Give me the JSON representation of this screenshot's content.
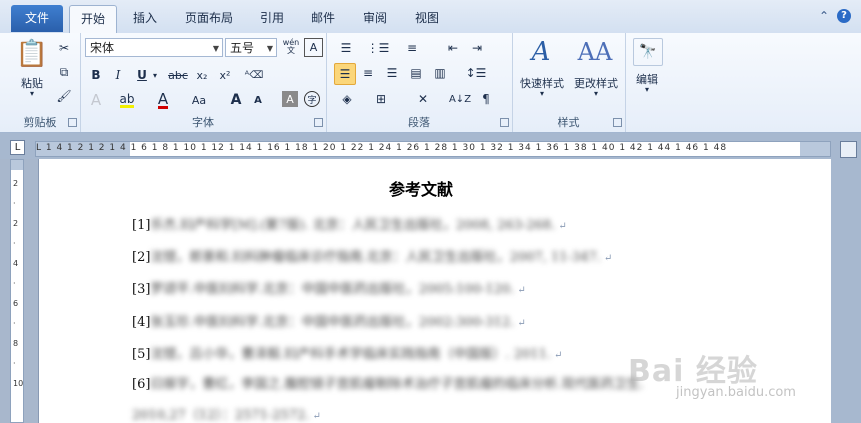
{
  "ribbon_tabs": {
    "file": "文件",
    "tabs": [
      "开始",
      "插入",
      "页面布局",
      "引用",
      "邮件",
      "审阅",
      "视图"
    ],
    "active_index": 0
  },
  "clipboard": {
    "paste": "粘贴",
    "group": "剪贴板"
  },
  "font": {
    "name": "宋体",
    "size": "五号",
    "group": "字体",
    "wen": "wén",
    "bold": "B",
    "italic": "I",
    "underline": "U",
    "strike": "abc",
    "sub": "x₂",
    "sup": "x²",
    "aa": "Aa",
    "grow": "A",
    "shrink": "A"
  },
  "paragraph": {
    "group": "段落"
  },
  "styles": {
    "quick": "快速样式",
    "change": "更改样式",
    "group": "样式"
  },
  "editing": {
    "label": "编辑"
  },
  "ruler": {
    "numbers": "L  1  4  1  2  1        2  1  4  1  6  1  8  1  10  1  12  1  14  1  16  1  18  1  20  1  22  1  24  1  26  1  28  1  30  1  32  1  34  1  36  1  38  1  40  1  42  1  44  1  46  1  48"
  },
  "document": {
    "title": "参考文献",
    "references": [
      {
        "num": "[1]",
        "text": "乐杰.妇产科学[M].(第7版). 北京：人民卫生出版社，2008, 263-268."
      },
      {
        "num": "[2]",
        "text": "沈铿，郎景和.妇科肿瘤临床诊疗指南.北京：人民卫生出版社，2007, 11-347."
      },
      {
        "num": "[3]",
        "text": "罗颂平.中医妇科学.北京：中国中医药出版社，2005:100-120."
      },
      {
        "num": "[4]",
        "text": "张玉珍.中医妇科学.北京：中国中医药出版社，2002:300-312."
      },
      {
        "num": "[5]",
        "text": "沈铿，吕小华，曹泽毅.妇产科手术学临床实践指南（中国版）. 2011."
      },
      {
        "num": "[6]",
        "text": "曰振宇，曹红，李国之.腹腔镜子宫肌瘤剔除术治疗子宫肌瘤的临床分析.现代医药卫生."
      },
      {
        "num": "",
        "text": "2010,27（12）：2571-2572."
      }
    ]
  },
  "watermark": {
    "main": "Bai 经验",
    "sub": "jingyan.baidu.com"
  }
}
